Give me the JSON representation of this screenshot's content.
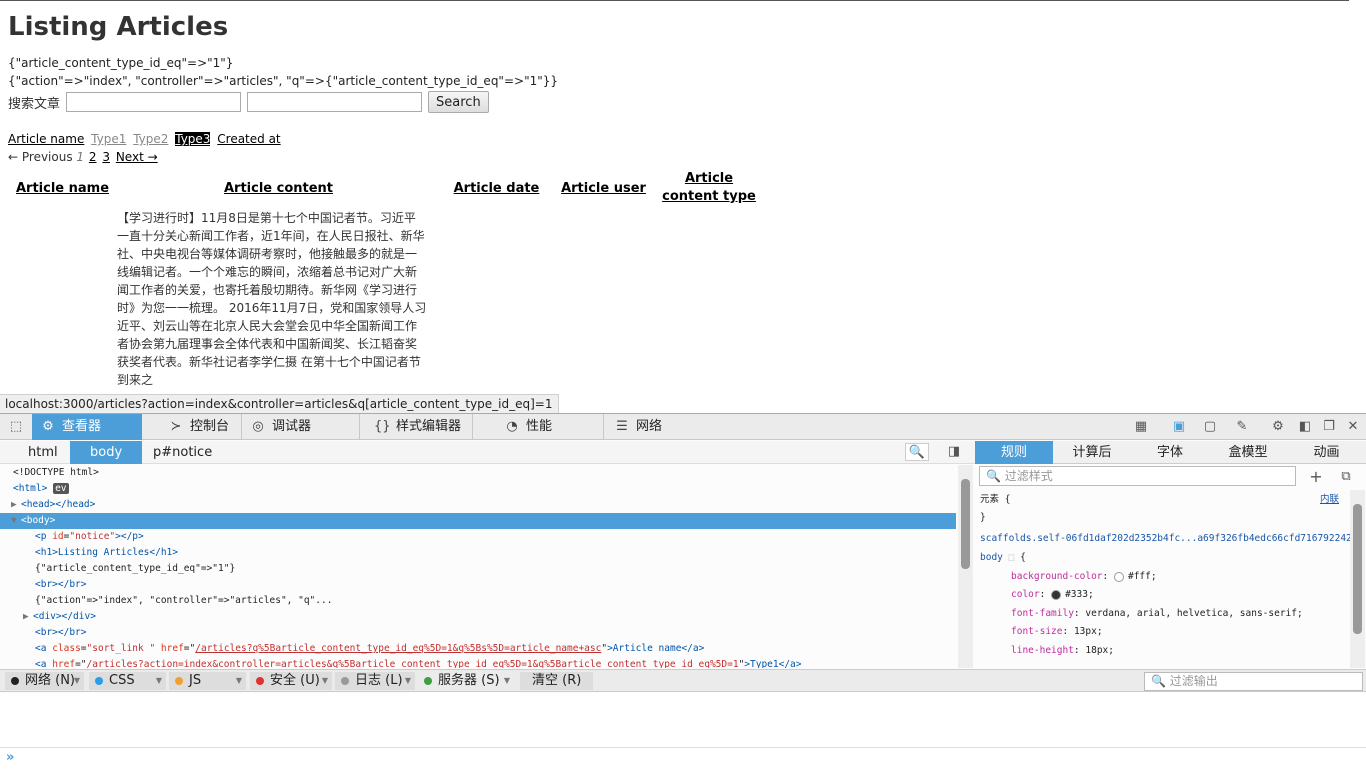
{
  "page": {
    "title": "Listing Articles",
    "params_line1": "{\"article_content_type_id_eq\"=>\"1\"}",
    "params_line2": "{\"action\"=>\"index\", \"controller\"=>\"articles\", \"q\"=>{\"article_content_type_id_eq\"=>\"1\"}}",
    "search": {
      "label": "搜索文章",
      "input1_value": "",
      "input2_value": "",
      "button": "Search"
    },
    "sort_links": [
      "Article name",
      "Type1",
      "Type2",
      "Type3",
      "Created at"
    ],
    "pagination": {
      "prev": "← Previous",
      "current": "1",
      "pages": [
        "2",
        "3"
      ],
      "next": "Next →"
    },
    "columns": [
      "Article name",
      "Article content",
      "Article date",
      "Article user",
      "Article content type"
    ],
    "first_row_content": "【学习进行时】11月8日是第十七个中国记者节。习近平一直十分关心新闻工作者，近1年间，在人民日报社、新华社、中央电视台等媒体调研考察时，他接触最多的就是一线编辑记者。一个个难忘的瞬间，浓缩着总书记对广大新闻工作者的关爱，也寄托着殷切期待。新华网《学习进行时》为您一一梳理。 2016年11月7日，党和国家领导人习近平、刘云山等在北京人民大会堂会见中华全国新闻工作者协会第九届理事会全体代表和中国新闻奖、长江韬奋奖获奖者代表。新华社记者李学仁摄         在第十七个中国记者节到来之"
  },
  "status_url": "localhost:3000/articles?action=index&controller=articles&q[article_content_type_id_eq]=1",
  "devtools": {
    "tabs": [
      {
        "label": "查看器",
        "icon": "inspector-icon"
      },
      {
        "label": "控制台",
        "icon": "console-icon"
      },
      {
        "label": "调试器",
        "icon": "debugger-icon"
      },
      {
        "label": "样式编辑器",
        "icon": "style-editor-icon"
      },
      {
        "label": "性能",
        "icon": "performance-icon"
      },
      {
        "label": "网络",
        "icon": "network-icon"
      }
    ],
    "breadcrumbs": [
      "html",
      "body",
      "p#notice"
    ],
    "markup": {
      "doctype": "<!DOCTYPE html>",
      "html_open": "<html>",
      "ev": "ev",
      "head": "<head></head>",
      "body": "<body>",
      "l_p_open": "<p",
      "l_p_attr": "id",
      "l_p_val": "\"notice\"",
      "l_p_close": "></p>",
      "h1": "<h1>Listing Articles</h1>",
      "text1": "{\"article_content_type_id_eq\"=>\"1\"}",
      "br1": "<br></br>",
      "text2": "{\"action\"=>\"index\", \"controller\"=>\"articles\", \"q\"...",
      "div": "<div></div>",
      "br2": "<br></br>",
      "a1_open": "<a",
      "a1_attr1": "class",
      "a1_val1": "\"sort_link \"",
      "a1_attr2": "href",
      "a1_href": "/articles?q%5Barticle_content_type_id_eq%5D=1&q%5Bs%5D=article_name+asc",
      "a1_text": ">Article name</a>",
      "a2_open": "<a",
      "a2_attr": "href",
      "a2_href": "/articles?action=index&controller=articles&q%5Barticle_content_type_id_eq%5D=1&q%5Barticle_content_type_id_eq%5D=1",
      "a2_text": ">Type1</a>"
    },
    "side_tabs": [
      "规则",
      "计算后",
      "字体",
      "盒模型",
      "动画"
    ],
    "filter_styles_placeholder": "过滤样式",
    "rules": {
      "element_selector": "元素 {",
      "inline": "内联",
      "close1": "}",
      "source": "scaffolds.self-06fd1daf202d2352b4fc...a69f326fb4edc66cfd71679224257.css:2",
      "body_selector": "body",
      "brace": "{",
      "props": [
        {
          "name": "background-color",
          "value": "#fff",
          "color": "#ffffff"
        },
        {
          "name": "color",
          "value": "#333",
          "color": "#333333"
        },
        {
          "name": "font-family",
          "value": "verdana, arial, helvetica, sans-serif"
        },
        {
          "name": "font-size",
          "value": "13px"
        },
        {
          "name": "line-height",
          "value": "18px"
        }
      ]
    },
    "console_filters": [
      {
        "label": "网络 (N)",
        "dot": "#222222"
      },
      {
        "label": "CSS",
        "dot": "#2a9ee8"
      },
      {
        "label": "JS",
        "dot": "#f0a030"
      },
      {
        "label": "安全 (U)",
        "dot": "#e03030"
      },
      {
        "label": "日志 (L)",
        "dot": "#999999"
      },
      {
        "label": "服务器 (S)",
        "dot": "#40a040"
      }
    ],
    "clear_button": "清空 (R)",
    "filter_output_placeholder": "过滤输出"
  }
}
